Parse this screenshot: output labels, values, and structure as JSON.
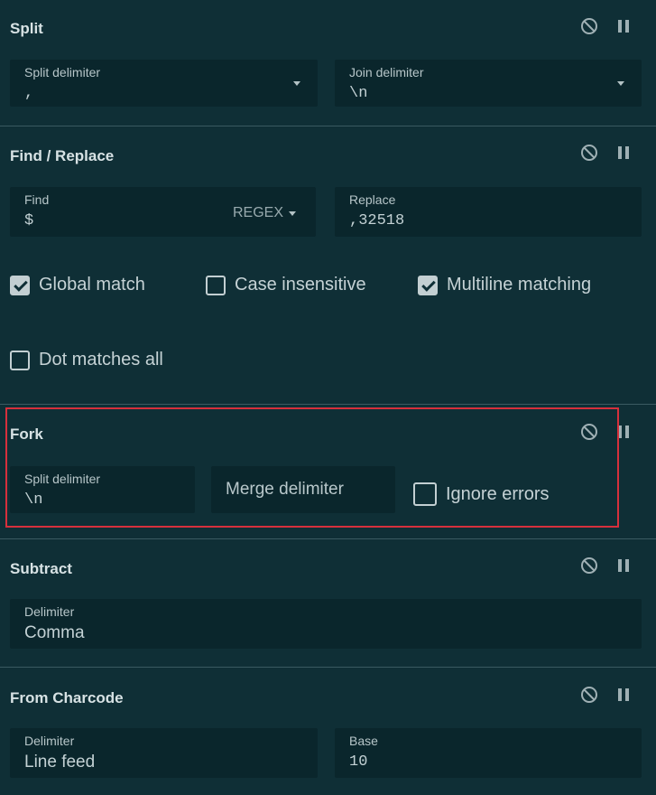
{
  "colors": {
    "background": "#0f2f36",
    "field": "#0a262c",
    "highlight": "#d6303c",
    "divider": "#3a5a61"
  },
  "icons": {
    "disable": "circle-slash-icon",
    "breakpoint": "pause-icon",
    "dropdown": "caret-down-icon"
  },
  "split": {
    "title": "Split",
    "split_label": "Split delimiter",
    "split_value": ",",
    "join_label": "Join delimiter",
    "join_value": "\\n"
  },
  "find_replace": {
    "title": "Find / Replace",
    "find_label": "Find",
    "find_value": "$",
    "find_mode": "REGEX",
    "replace_label": "Replace",
    "replace_value": ",32518",
    "options": {
      "global": {
        "label": "Global match",
        "checked": true
      },
      "case": {
        "label": "Case insensitive",
        "checked": false
      },
      "multiline": {
        "label": "Multiline matching",
        "checked": true
      },
      "dotall": {
        "label": "Dot matches all",
        "checked": false
      }
    }
  },
  "fork": {
    "title": "Fork",
    "split_label": "Split delimiter",
    "split_value": "\\n",
    "merge_placeholder": "Merge delimiter",
    "ignore_errors_label": "Ignore errors",
    "ignore_errors_checked": false
  },
  "subtract": {
    "title": "Subtract",
    "delimiter_label": "Delimiter",
    "delimiter_value": "Comma"
  },
  "from_charcode": {
    "title": "From Charcode",
    "delimiter_label": "Delimiter",
    "delimiter_value": "Line feed",
    "base_label": "Base",
    "base_value": "10"
  }
}
